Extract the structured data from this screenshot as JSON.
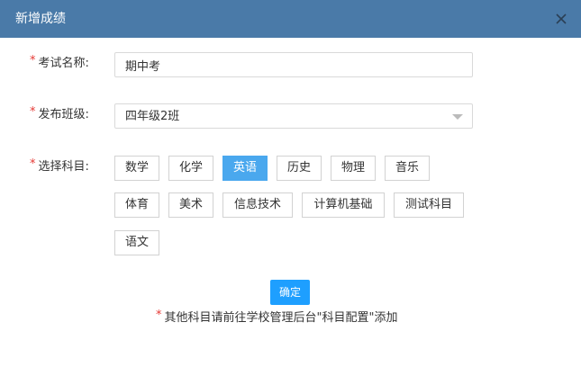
{
  "dialog": {
    "title": "新增成绩",
    "close_icon": "close-icon"
  },
  "form": {
    "required_mark": "*",
    "exam_name": {
      "label": "考试名称:",
      "value": "期中考"
    },
    "class": {
      "label": "发布班级:",
      "selected": "四年级2班"
    },
    "subjects": {
      "label": "选择科目:",
      "items": [
        {
          "label": "数学",
          "selected": false
        },
        {
          "label": "化学",
          "selected": false
        },
        {
          "label": "英语",
          "selected": true
        },
        {
          "label": "历史",
          "selected": false
        },
        {
          "label": "物理",
          "selected": false
        },
        {
          "label": "音乐",
          "selected": false
        },
        {
          "label": "体育",
          "selected": false
        },
        {
          "label": "美术",
          "selected": false
        },
        {
          "label": "信息技术",
          "selected": false
        },
        {
          "label": "计算机基础",
          "selected": false
        },
        {
          "label": "测试科目",
          "selected": false
        },
        {
          "label": "语文",
          "selected": false
        }
      ]
    },
    "confirm_label": "确定",
    "note": "其他科目请前往学校管理后台\"科目配置\"添加"
  },
  "colors": {
    "title_bar": "#4a7aa8",
    "active_subject": "#4aa8ee",
    "confirm_button": "#1e9fff",
    "required": "#e53935"
  }
}
